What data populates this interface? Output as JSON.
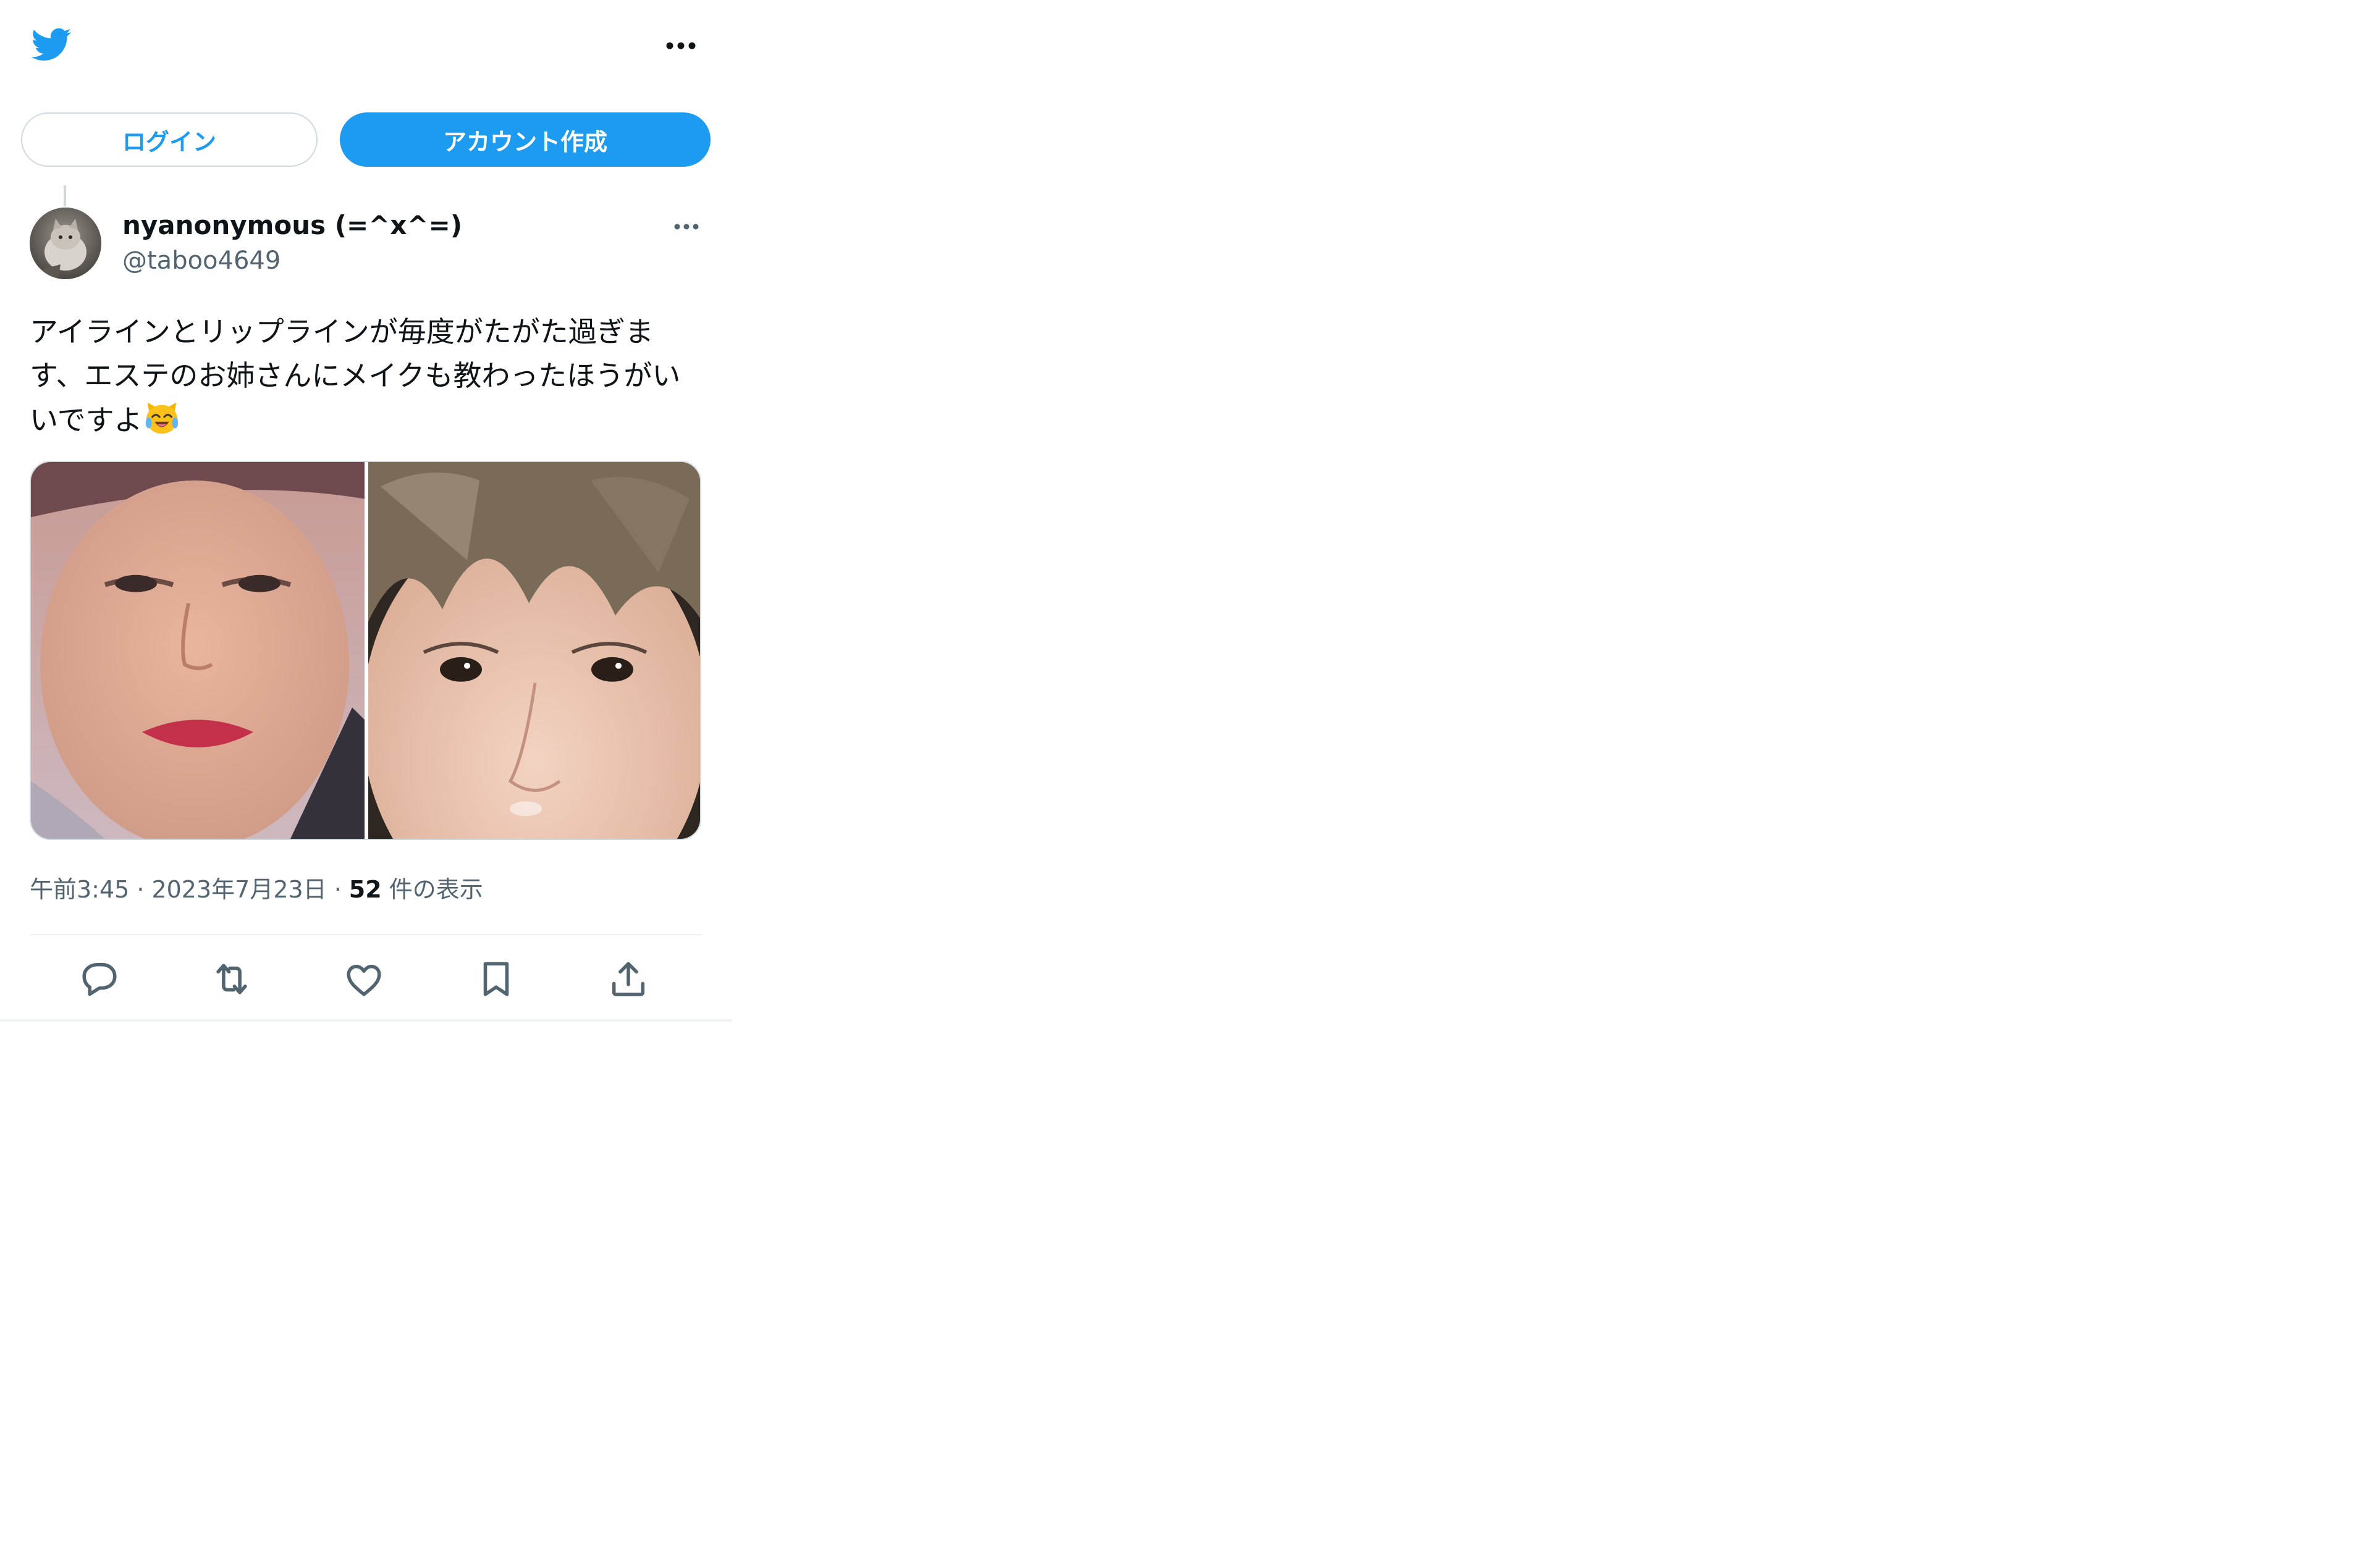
{
  "header": {
    "logo_icon": "twitter-bird-icon",
    "more_icon": "more-horizontal-icon"
  },
  "auth": {
    "login_label": "ログイン",
    "signup_label": "アカウント作成"
  },
  "tweet": {
    "display_name": "nyanonymous (=^x^=)",
    "handle": "@taboo4649",
    "text": "アイラインとリップラインが毎度がたがた過ぎます、エステのお姉さんにメイクも教わったほうがいいですよ",
    "emoji": "face-with-tears-of-joy-cat",
    "media": {
      "count": 2
    },
    "time": "午前3:45",
    "date": "2023年7月23日",
    "separator": "·",
    "views_count": "52",
    "views_label": "件の表示"
  },
  "actions": [
    {
      "name": "reply-icon"
    },
    {
      "name": "retweet-icon"
    },
    {
      "name": "like-icon"
    },
    {
      "name": "bookmark-icon"
    },
    {
      "name": "share-icon"
    }
  ],
  "colors": {
    "accent": "#1d9bf0",
    "text": "#0f1419",
    "secondary": "#536471",
    "border": "#cfd9de"
  }
}
